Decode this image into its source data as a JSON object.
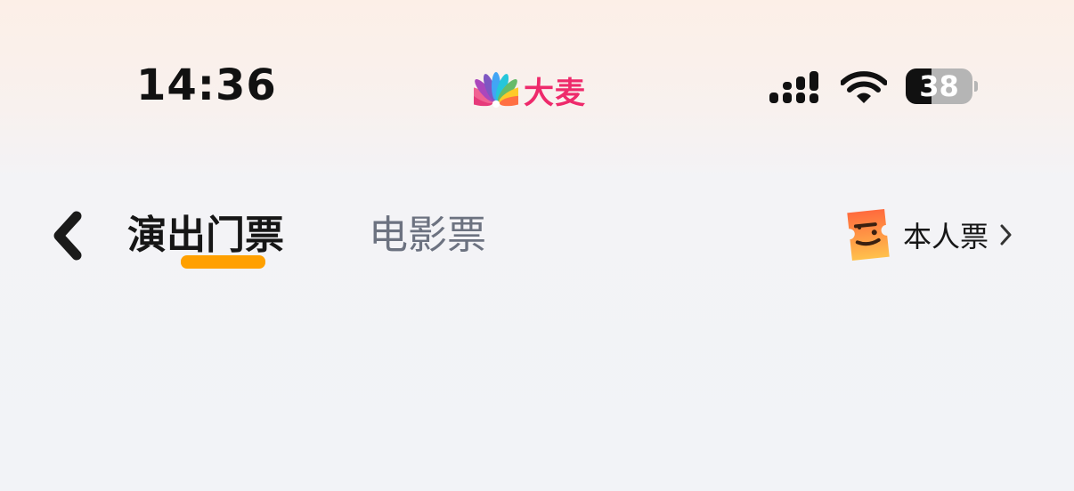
{
  "status_bar": {
    "time": "14:36",
    "brand_name": "大麦",
    "brand_color": "#ee2a6b",
    "battery_level": "38",
    "battery_fraction": 0.38,
    "icons": [
      "signal-icon",
      "wifi-icon",
      "battery-icon"
    ]
  },
  "nav": {
    "back_icon": "chevron-left-icon",
    "tabs": [
      {
        "label": "演出门票",
        "active": true
      },
      {
        "label": "电影票",
        "active": false
      }
    ],
    "active_color": "#ffa000",
    "personal_ticket": {
      "label": "本人票",
      "icon": "ticket-face-icon"
    }
  }
}
